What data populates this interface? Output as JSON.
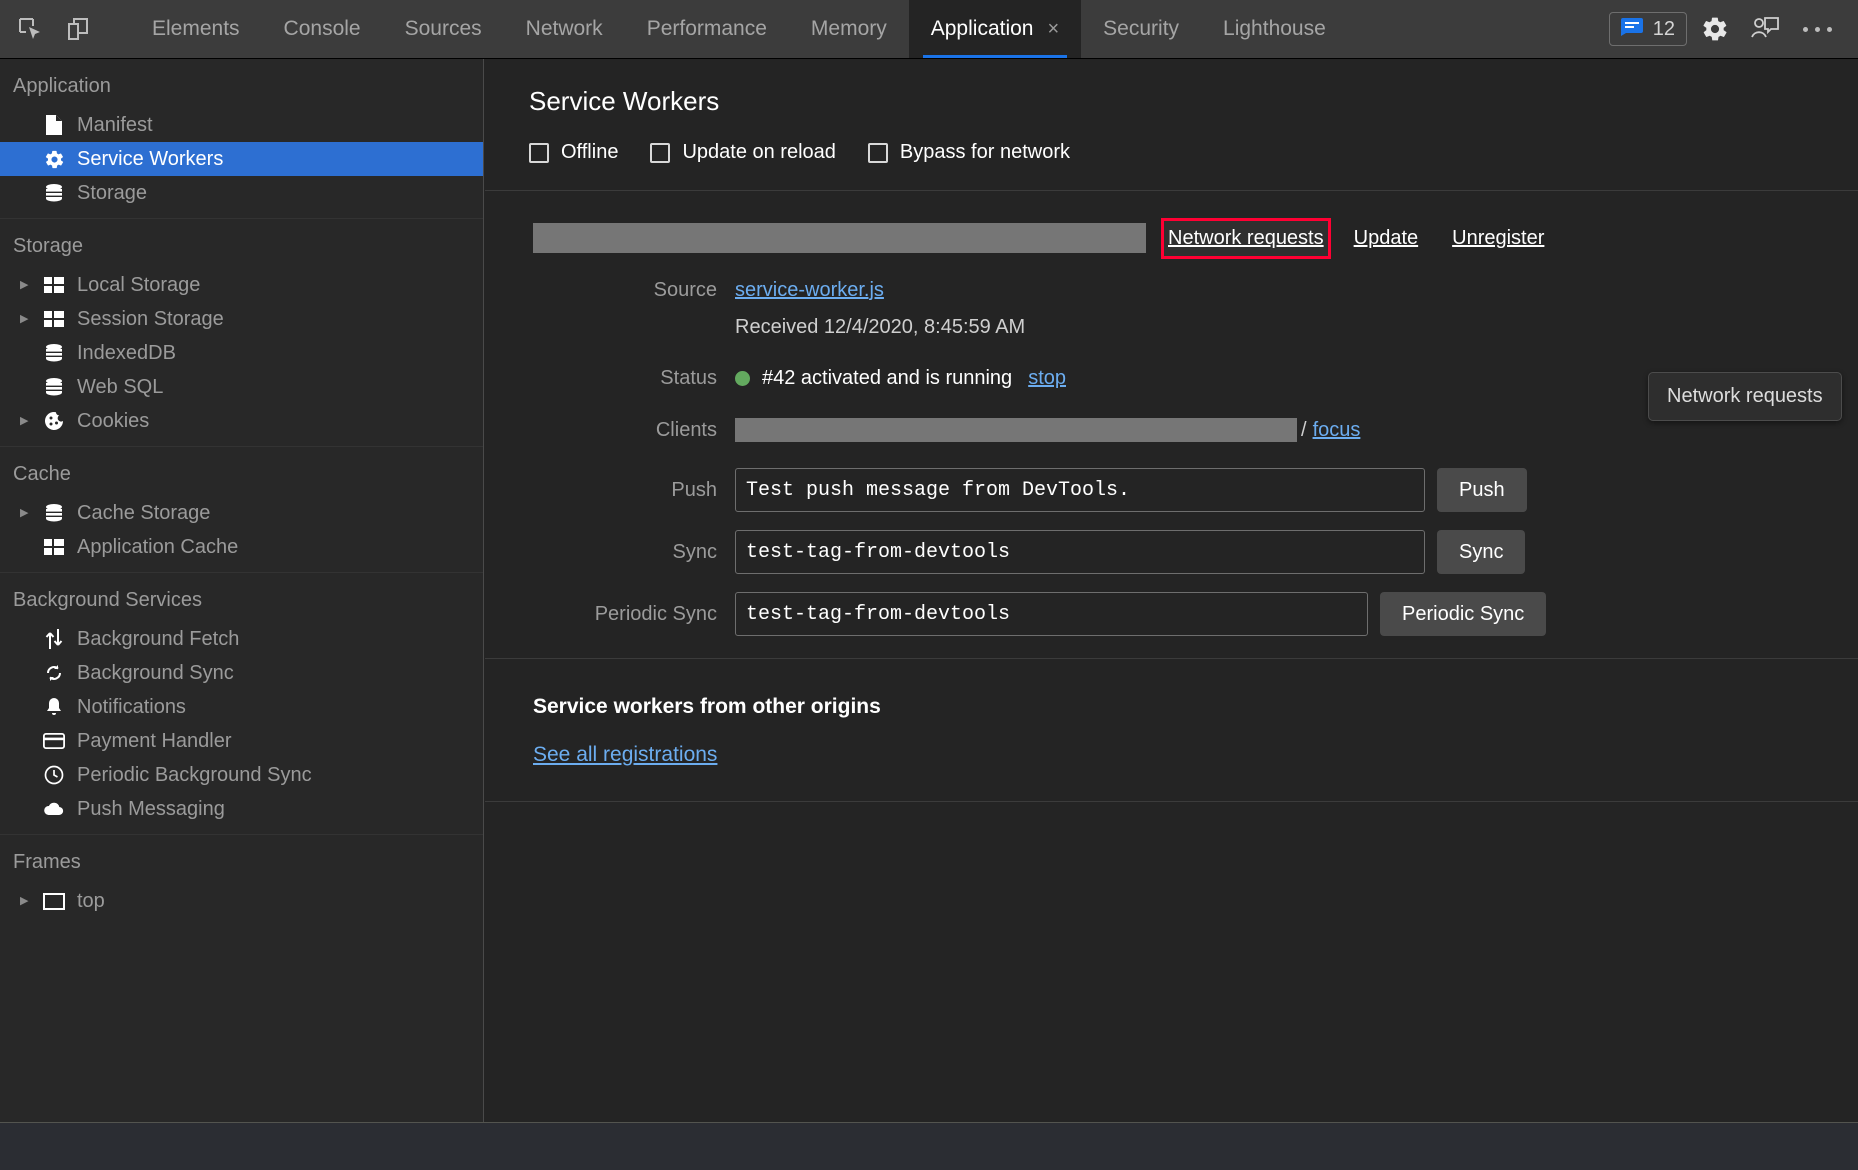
{
  "toolbar": {
    "icons": [
      {
        "name": "inspect-element-icon",
        "label": "Inspect element"
      },
      {
        "name": "device-toolbar-icon",
        "label": "Toggle device toolbar"
      }
    ],
    "tabs": [
      {
        "label": "Elements",
        "active": false
      },
      {
        "label": "Console",
        "active": false
      },
      {
        "label": "Sources",
        "active": false
      },
      {
        "label": "Network",
        "active": false
      },
      {
        "label": "Performance",
        "active": false
      },
      {
        "label": "Memory",
        "active": false
      },
      {
        "label": "Application",
        "active": true,
        "close": "×"
      },
      {
        "label": "Security",
        "active": false
      },
      {
        "label": "Lighthouse",
        "active": false
      }
    ],
    "issues_count": "12",
    "issues_icon": "issues-message-icon",
    "settings_icon": "gear-icon",
    "feedback_icon": "feedback-person-icon",
    "more_icon": "more-vertical-icon"
  },
  "sidebar": {
    "groups": [
      {
        "title": "Application",
        "items": [
          {
            "label": "Manifest",
            "icon": "document-icon",
            "expandable": false,
            "selected": false
          },
          {
            "label": "Service Workers",
            "icon": "gear-icon",
            "expandable": false,
            "selected": true
          },
          {
            "label": "Storage",
            "icon": "database-icon",
            "expandable": false,
            "selected": false
          }
        ]
      },
      {
        "title": "Storage",
        "items": [
          {
            "label": "Local Storage",
            "icon": "table-icon",
            "expandable": true,
            "selected": false
          },
          {
            "label": "Session Storage",
            "icon": "table-icon",
            "expandable": true,
            "selected": false
          },
          {
            "label": "IndexedDB",
            "icon": "database-icon",
            "expandable": false,
            "selected": false
          },
          {
            "label": "Web SQL",
            "icon": "database-icon",
            "expandable": false,
            "selected": false
          },
          {
            "label": "Cookies",
            "icon": "cookie-icon",
            "expandable": true,
            "selected": false
          }
        ]
      },
      {
        "title": "Cache",
        "items": [
          {
            "label": "Cache Storage",
            "icon": "database-icon",
            "expandable": true,
            "selected": false
          },
          {
            "label": "Application Cache",
            "icon": "table-icon",
            "expandable": false,
            "selected": false
          }
        ]
      },
      {
        "title": "Background Services",
        "items": [
          {
            "label": "Background Fetch",
            "icon": "updown-arrows-icon",
            "expandable": false,
            "selected": false
          },
          {
            "label": "Background Sync",
            "icon": "sync-icon",
            "expandable": false,
            "selected": false
          },
          {
            "label": "Notifications",
            "icon": "bell-icon",
            "expandable": false,
            "selected": false
          },
          {
            "label": "Payment Handler",
            "icon": "credit-card-icon",
            "expandable": false,
            "selected": false
          },
          {
            "label": "Periodic Background Sync",
            "icon": "clock-icon",
            "expandable": false,
            "selected": false
          },
          {
            "label": "Push Messaging",
            "icon": "cloud-icon",
            "expandable": false,
            "selected": false
          }
        ]
      },
      {
        "title": "Frames",
        "items": [
          {
            "label": "top",
            "icon": "frame-icon",
            "expandable": true,
            "selected": false
          }
        ]
      }
    ]
  },
  "main": {
    "title": "Service Workers",
    "options": [
      {
        "label": "Offline",
        "checked": false
      },
      {
        "label": "Update on reload",
        "checked": false
      },
      {
        "label": "Bypass for network",
        "checked": false
      }
    ],
    "actions": {
      "network_requests": "Network requests",
      "update": "Update",
      "unregister": "Unregister"
    },
    "tooltip": "Network requests",
    "rows": {
      "source_label": "Source",
      "source_value": "service-worker.js",
      "received_value": "Received 12/4/2020, 8:45:59 AM",
      "status_label": "Status",
      "status_value": "#42 activated and is running",
      "status_color": "#63a95f",
      "stop_link": "stop",
      "clients_label": "Clients",
      "clients_separator": "/",
      "focus_link": "focus",
      "push_label": "Push",
      "push_value": "Test push message from DevTools.",
      "push_button": "Push",
      "sync_label": "Sync",
      "sync_value": "test-tag-from-devtools",
      "sync_button": "Sync",
      "periodic_sync_label": "Periodic Sync",
      "periodic_sync_value": "test-tag-from-devtools",
      "periodic_sync_button": "Periodic Sync"
    },
    "other_origins": {
      "title": "Service workers from other origins",
      "see_all": "See all registrations"
    }
  },
  "colors": {
    "accent_blue": "#1a73e8",
    "selection_blue": "#2d6fd2",
    "link_blue": "#6cadf0",
    "highlight_red": "#ff0033",
    "status_green": "#63a95f"
  }
}
